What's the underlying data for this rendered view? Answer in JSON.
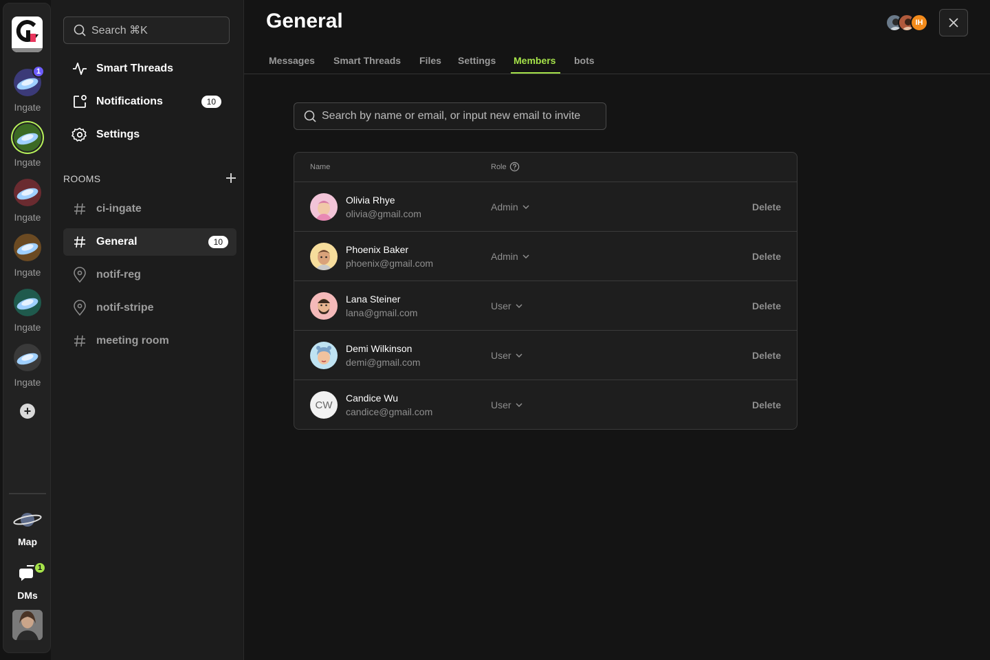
{
  "rail": {
    "workspaces": [
      {
        "label": "Ingate",
        "badge": "1",
        "bg": "#3b3a78"
      },
      {
        "label": "Ingate",
        "badge": "",
        "bg": "#3c6a24"
      },
      {
        "label": "Ingate",
        "badge": "",
        "bg": "#6a2b30"
      },
      {
        "label": "Ingate",
        "badge": "",
        "bg": "#6b4a22"
      },
      {
        "label": "Ingate",
        "badge": "",
        "bg": "#1f5a4d"
      },
      {
        "label": "Ingate",
        "badge": "",
        "bg": "#3a3a3a"
      }
    ],
    "map_label": "Map",
    "dms_label": "DMs",
    "dms_badge": "1"
  },
  "sidebar": {
    "search_placeholder": "Search ⌘K",
    "nav": [
      {
        "label": "Smart Threads",
        "icon": "activity-icon"
      },
      {
        "label": "Notifications",
        "icon": "notification-icon",
        "count": "10"
      },
      {
        "label": "Settings",
        "icon": "gear-icon"
      }
    ],
    "rooms_header": "ROOMS",
    "rooms": [
      {
        "label": "ci-ingate",
        "icon": "hash-icon"
      },
      {
        "label": "General",
        "icon": "hash-icon",
        "count": "10"
      },
      {
        "label": "notif-reg",
        "icon": "pin-icon"
      },
      {
        "label": "notif-stripe",
        "icon": "pin-icon"
      },
      {
        "label": "meeting room",
        "icon": "hash-icon"
      }
    ]
  },
  "main": {
    "title": "General",
    "avatar_initials": "IH",
    "tabs": [
      "Messages",
      "Smart Threads",
      "Files",
      "Settings",
      "Members",
      "bots"
    ],
    "active_tab": "Members",
    "search_placeholder": "Search by name or email, or input new email to invite",
    "table": {
      "col_name": "Name",
      "col_role": "Role",
      "members": [
        {
          "name": "Olivia Rhye",
          "email": "olivia@gmail.com",
          "role": "Admin",
          "action": "Delete",
          "avatar_bg": "#f2c4d8"
        },
        {
          "name": "Phoenix Baker",
          "email": "phoenix@gmail.com",
          "role": "Admin",
          "action": "Delete",
          "avatar_bg": "#f6dd9c"
        },
        {
          "name": "Lana Steiner",
          "email": "lana@gmail.com",
          "role": "User",
          "action": "Delete",
          "avatar_bg": "#f4b9b9"
        },
        {
          "name": "Demi Wilkinson",
          "email": "demi@gmail.com",
          "role": "User",
          "action": "Delete",
          "avatar_bg": "#bfe3f2"
        },
        {
          "name": "Candice Wu",
          "email": "candice@gmail.com",
          "role": "User",
          "action": "Delete",
          "initials": "CW"
        }
      ]
    }
  },
  "colors": {
    "accent": "#a6e34a",
    "badge_purple": "#6d5dfc",
    "orange": "#f38b1c"
  }
}
